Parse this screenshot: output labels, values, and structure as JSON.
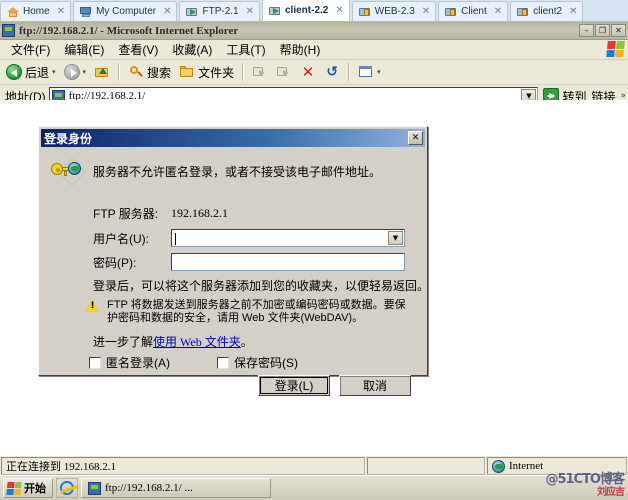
{
  "browser_tabs": [
    {
      "label": "Home",
      "icon": "home-icon",
      "active": false
    },
    {
      "label": "My Computer",
      "icon": "computer-icon",
      "active": false
    },
    {
      "label": "FTP-2.1",
      "icon": "folder-green-icon",
      "active": false
    },
    {
      "label": "client-2.2",
      "icon": "folder-green-icon",
      "active": true
    },
    {
      "label": "WEB-2.3",
      "icon": "folder-lock-icon",
      "active": false
    },
    {
      "label": "Client",
      "icon": "folder-lock-icon",
      "active": false
    },
    {
      "label": "client2",
      "icon": "folder-lock-icon",
      "active": false
    }
  ],
  "tab_close_glyph": "✕",
  "window": {
    "title": "ftp://192.168.2.1/ - Microsoft Internet Explorer",
    "minimize": "–",
    "maximize": "❐",
    "close": "✕"
  },
  "menu": [
    {
      "label": "文件(F)"
    },
    {
      "label": "编辑(E)"
    },
    {
      "label": "查看(V)"
    },
    {
      "label": "收藏(A)"
    },
    {
      "label": "工具(T)"
    },
    {
      "label": "帮助(H)"
    }
  ],
  "toolbar": {
    "back_label": "后退",
    "back_caret": "▾",
    "forward_caret": "▾",
    "up_label": "",
    "search_label": "搜索",
    "folders_label": "文件夹",
    "delete_glyph": "✕",
    "undo_glyph": "↺",
    "views_caret": "▾"
  },
  "address_bar": {
    "label": "地址(D)",
    "value": "ftp://192.168.2.1/",
    "dropdown_glyph": "▼",
    "go_label": "转到",
    "go_glyph": "➜",
    "links_label": "链接",
    "links_chevron": "»"
  },
  "dialog": {
    "title": "登录身份",
    "close_glyph": "✕",
    "message": "服务器不允许匿名登录，或者不接受该电子邮件地址。",
    "server_label": "FTP 服务器:",
    "server_value": "192.168.2.1",
    "username_label": "用户名(U):",
    "username_value": "",
    "username_dropdown_glyph": "▼",
    "password_label": "密码(P):",
    "password_value": "",
    "favorites_hint": "登录后，可以将这个服务器添加到您的收藏夹，以便轻易返回。",
    "warning_text": "FTP 将数据发送到服务器之前不加密或编码密码或数据。要保护密码和数据的安全，请用 Web 文件夹(WebDAV)。",
    "learn_prefix": "进一步了解",
    "learn_link": "使用 Web 文件夹",
    "learn_suffix": "。",
    "anonymous_label": "匿名登录(A)",
    "anonymous_checked": false,
    "save_password_label": "保存密码(S)",
    "save_password_checked": false,
    "login_button": "登录(L)",
    "cancel_button": "取消"
  },
  "status_bar": {
    "message": "正在连接到 192.168.2.1",
    "middle": "",
    "zone": "Internet"
  },
  "taskbar": {
    "start_label": "开始",
    "task_label": "ftp://192.168.2.1/ ...",
    "watermark": "@51CTO博客",
    "watermark_sub": "刘应吉"
  },
  "colors": {
    "dialog_face": "#d4d0c8",
    "dialog_title_start": "#0a246a",
    "dialog_title_end": "#8fb3dd",
    "chrome_face": "#ece9d8",
    "tabstrip": "#d6e3f0",
    "link": "#0000c8"
  }
}
